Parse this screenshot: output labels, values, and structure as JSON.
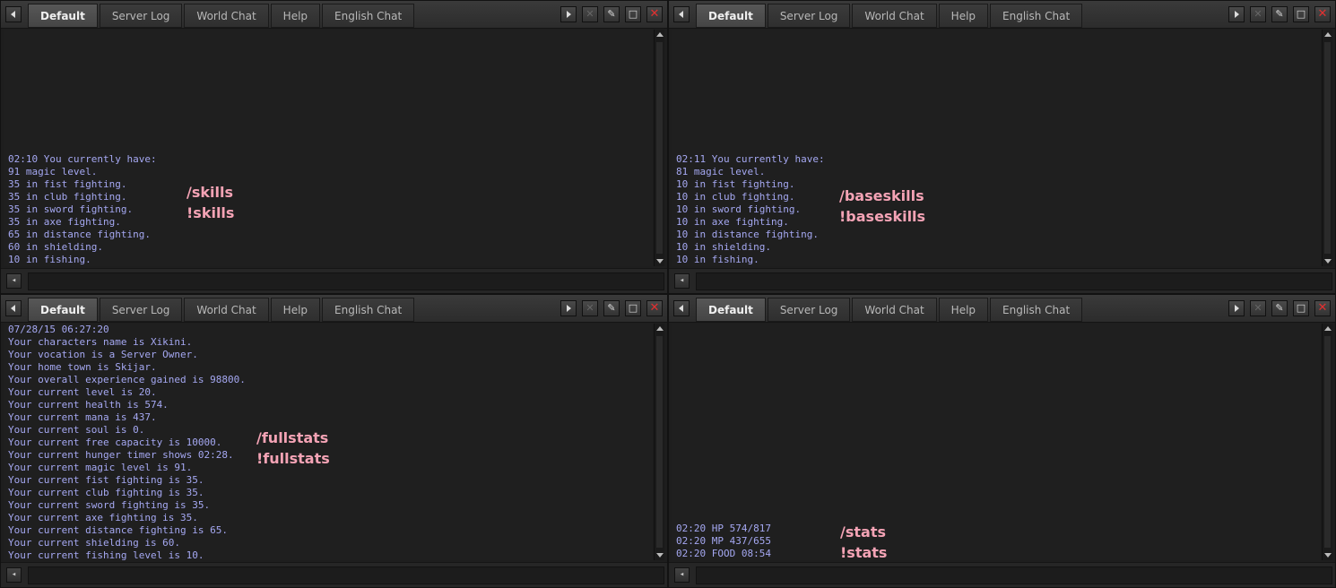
{
  "tabs": [
    "Default",
    "Server Log",
    "World Chat",
    "Help",
    "English Chat"
  ],
  "icons": {
    "left": "arrow-left-icon",
    "right": "arrow-right-icon",
    "close_tab": "close-tab-icon",
    "clear": "broom-icon",
    "window": "window-icon",
    "close": "close-icon",
    "speaker": "speaker-icon"
  },
  "colors": {
    "message": "#a5a8f2",
    "note": "#f4a3b5",
    "close": "#e23030"
  },
  "panels": {
    "top_left": {
      "messages": [
        "02:10 You currently have:",
        "91 magic level.",
        "35 in fist fighting.",
        "35 in club fighting.",
        "35 in sword fighting.",
        "35 in axe fighting.",
        "65 in distance fighting.",
        "60 in shielding.",
        "10 in fishing."
      ],
      "notes": [
        "/skills",
        "!skills"
      ]
    },
    "top_right": {
      "messages": [
        "02:11 You currently have:",
        "81 magic level.",
        "10 in fist fighting.",
        "10 in club fighting.",
        "10 in sword fighting.",
        "10 in axe fighting.",
        "10 in distance fighting.",
        "10 in shielding.",
        "10 in fishing."
      ],
      "notes": [
        "/baseskills",
        "!baseskills"
      ]
    },
    "bottom_left": {
      "messages": [
        "07/28/15 06:27:20",
        "Your characters name is Xikini.",
        "Your vocation is a Server Owner.",
        "Your home town is Skijar.",
        "Your overall experience gained is 98800.",
        "Your current level is 20.",
        "Your current health is 574.",
        "Your current mana is 437.",
        "Your current soul is 0.",
        "Your current free capacity is 10000.",
        "Your current hunger timer shows 02:28.",
        "Your current magic level is 91.",
        "Your current fist fighting is 35.",
        "Your current club fighting is 35.",
        "Your current sword fighting is 35.",
        "Your current axe fighting is 35.",
        "Your current distance fighting is 65.",
        "Your current shielding is 60.",
        "Your current fishing level is 10."
      ],
      "notes": [
        "/fullstats",
        "!fullstats"
      ]
    },
    "bottom_right": {
      "messages": [
        "02:20 HP 574/817",
        "02:20 MP 437/655",
        "02:20 FOOD 08:54"
      ],
      "notes": [
        "/stats",
        "!stats"
      ]
    }
  }
}
